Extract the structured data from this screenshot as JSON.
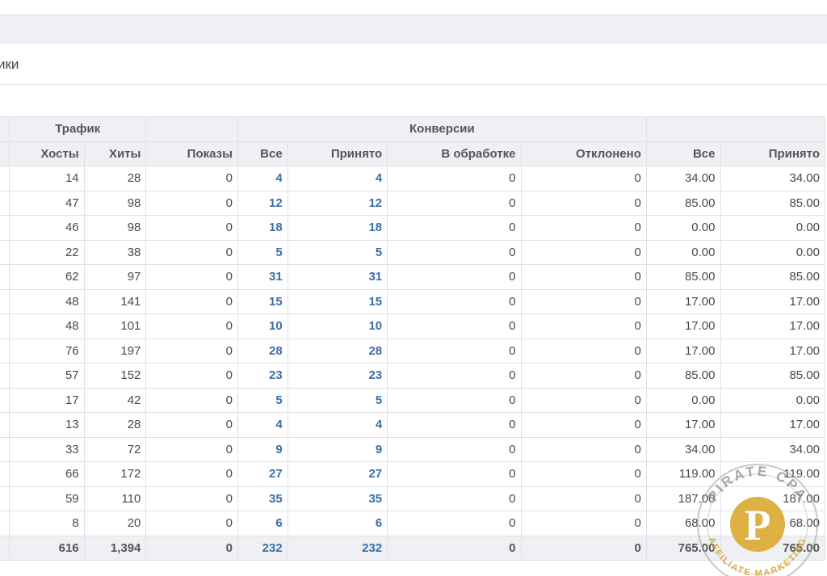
{
  "page": {
    "title_fragment": "ики"
  },
  "table": {
    "groups": {
      "traffic": "Трафик",
      "conversions": "Конверсии"
    },
    "columns": {
      "hosts": "Хосты",
      "hits": "Хиты",
      "impressions": "Показы",
      "conv_all": "Все",
      "conv_accepted": "Принято",
      "conv_pending": "В обработке",
      "conv_rejected": "Отклонено",
      "pay_all": "Все",
      "pay_accepted": "Принято"
    },
    "rows": [
      {
        "hosts": "14",
        "hits": "28",
        "impressions": "0",
        "conv_all": "4",
        "conv_accepted": "4",
        "conv_pending": "0",
        "conv_rejected": "0",
        "pay_all": "34.00",
        "pay_accepted": "34.00"
      },
      {
        "hosts": "47",
        "hits": "98",
        "impressions": "0",
        "conv_all": "12",
        "conv_accepted": "12",
        "conv_pending": "0",
        "conv_rejected": "0",
        "pay_all": "85.00",
        "pay_accepted": "85.00"
      },
      {
        "hosts": "46",
        "hits": "98",
        "impressions": "0",
        "conv_all": "18",
        "conv_accepted": "18",
        "conv_pending": "0",
        "conv_rejected": "0",
        "pay_all": "0.00",
        "pay_accepted": "0.00"
      },
      {
        "hosts": "22",
        "hits": "38",
        "impressions": "0",
        "conv_all": "5",
        "conv_accepted": "5",
        "conv_pending": "0",
        "conv_rejected": "0",
        "pay_all": "0.00",
        "pay_accepted": "0.00"
      },
      {
        "hosts": "62",
        "hits": "97",
        "impressions": "0",
        "conv_all": "31",
        "conv_accepted": "31",
        "conv_pending": "0",
        "conv_rejected": "0",
        "pay_all": "85.00",
        "pay_accepted": "85.00"
      },
      {
        "hosts": "48",
        "hits": "141",
        "impressions": "0",
        "conv_all": "15",
        "conv_accepted": "15",
        "conv_pending": "0",
        "conv_rejected": "0",
        "pay_all": "17.00",
        "pay_accepted": "17.00"
      },
      {
        "hosts": "48",
        "hits": "101",
        "impressions": "0",
        "conv_all": "10",
        "conv_accepted": "10",
        "conv_pending": "0",
        "conv_rejected": "0",
        "pay_all": "17.00",
        "pay_accepted": "17.00"
      },
      {
        "hosts": "76",
        "hits": "197",
        "impressions": "0",
        "conv_all": "28",
        "conv_accepted": "28",
        "conv_pending": "0",
        "conv_rejected": "0",
        "pay_all": "17.00",
        "pay_accepted": "17.00"
      },
      {
        "hosts": "57",
        "hits": "152",
        "impressions": "0",
        "conv_all": "23",
        "conv_accepted": "23",
        "conv_pending": "0",
        "conv_rejected": "0",
        "pay_all": "85.00",
        "pay_accepted": "85.00"
      },
      {
        "hosts": "17",
        "hits": "42",
        "impressions": "0",
        "conv_all": "5",
        "conv_accepted": "5",
        "conv_pending": "0",
        "conv_rejected": "0",
        "pay_all": "0.00",
        "pay_accepted": "0.00"
      },
      {
        "hosts": "13",
        "hits": "28",
        "impressions": "0",
        "conv_all": "4",
        "conv_accepted": "4",
        "conv_pending": "0",
        "conv_rejected": "0",
        "pay_all": "17.00",
        "pay_accepted": "17.00"
      },
      {
        "hosts": "33",
        "hits": "72",
        "impressions": "0",
        "conv_all": "9",
        "conv_accepted": "9",
        "conv_pending": "0",
        "conv_rejected": "0",
        "pay_all": "34.00",
        "pay_accepted": "34.00"
      },
      {
        "hosts": "66",
        "hits": "172",
        "impressions": "0",
        "conv_all": "27",
        "conv_accepted": "27",
        "conv_pending": "0",
        "conv_rejected": "0",
        "pay_all": "119.00",
        "pay_accepted": "119.00"
      },
      {
        "hosts": "59",
        "hits": "110",
        "impressions": "0",
        "conv_all": "35",
        "conv_accepted": "35",
        "conv_pending": "0",
        "conv_rejected": "0",
        "pay_all": "187.00",
        "pay_accepted": "187.00"
      },
      {
        "hosts": "8",
        "hits": "20",
        "impressions": "0",
        "conv_all": "6",
        "conv_accepted": "6",
        "conv_pending": "0",
        "conv_rejected": "0",
        "pay_all": "68.00",
        "pay_accepted": "68.00"
      }
    ],
    "totals": {
      "hosts": "616",
      "hits": "1,394",
      "impressions": "0",
      "conv_all": "232",
      "conv_accepted": "232",
      "conv_pending": "0",
      "conv_rejected": "0",
      "pay_all": "765.00",
      "pay_accepted": "765.00"
    }
  },
  "watermark": {
    "top_text": "PIRATE CPA",
    "bottom_text": "AFFILIATE MARKETING",
    "letter": "P",
    "colors": {
      "gold": "#d9a62a",
      "ring": "#8a8a8a"
    }
  },
  "colors": {
    "link": "#3b6ea8",
    "header_bg": "#eef0f4",
    "border": "#dde1e6"
  }
}
